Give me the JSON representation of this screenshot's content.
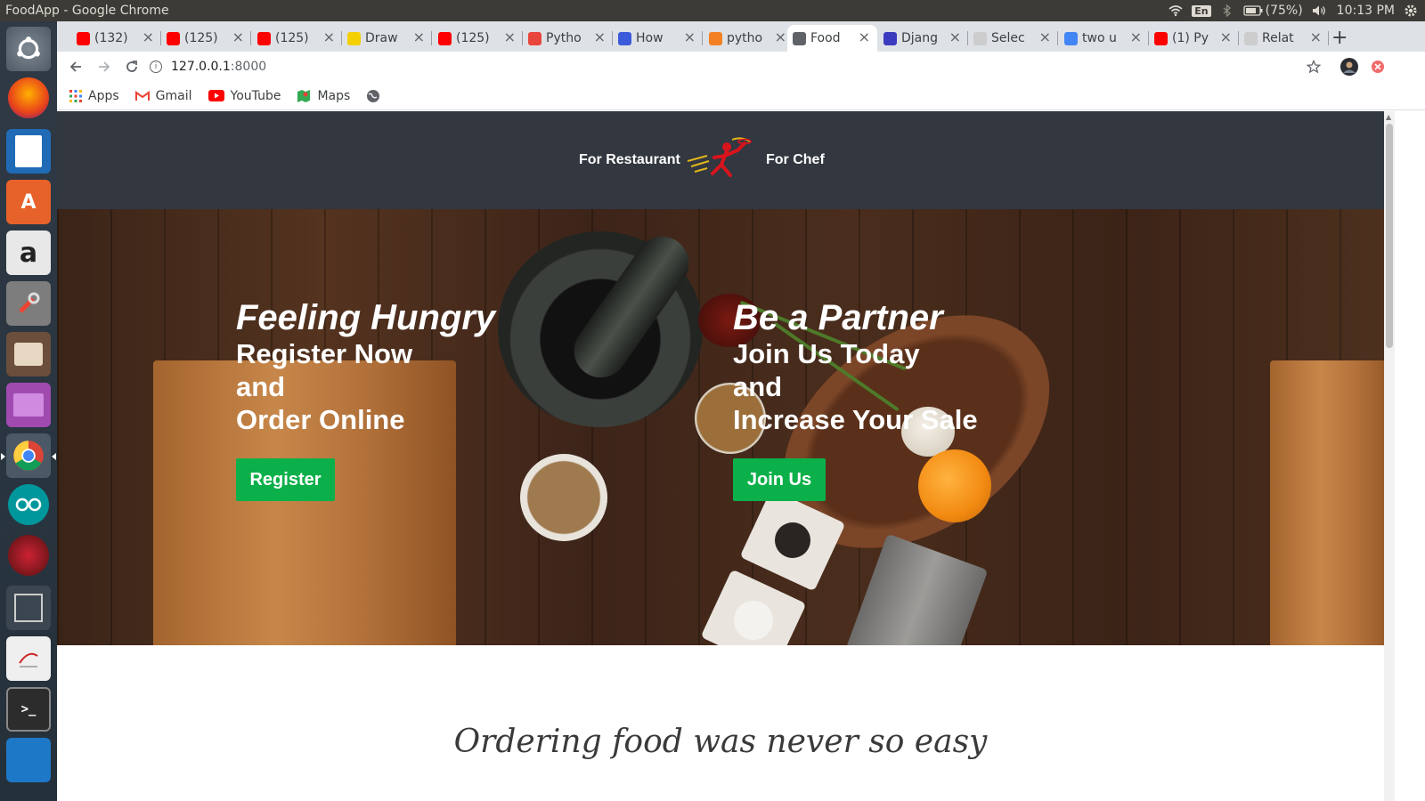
{
  "system": {
    "window_title": "FoodApp - Google Chrome",
    "lang": "En",
    "battery": "(75%)",
    "clock": "10:13 PM"
  },
  "launcher": {
    "items": [
      "dash",
      "firefox",
      "libreoffice-writer",
      "software-center",
      "amazon",
      "system-settings",
      "files",
      "media",
      "chrome",
      "arduino",
      "app",
      "workspace",
      "editor",
      "terminal",
      "vscode"
    ]
  },
  "tabs": [
    {
      "label": "(132)",
      "favicon": "youtube-icon",
      "color": "#ff0000"
    },
    {
      "label": "(125)",
      "favicon": "youtube-icon",
      "color": "#ff0000"
    },
    {
      "label": "(125)",
      "favicon": "youtube-icon",
      "color": "#ff0000"
    },
    {
      "label": "Draw",
      "favicon": "ejs-icon",
      "color": "#f5d000"
    },
    {
      "label": "(125)",
      "favicon": "youtube-icon",
      "color": "#ff0000"
    },
    {
      "label": "Pytho",
      "favicon": "python-icon",
      "color": "#e8453c"
    },
    {
      "label": "How",
      "favicon": "circle-icon",
      "color": "#3b5bdb"
    },
    {
      "label": "pytho",
      "favicon": "stackoverflow-icon",
      "color": "#f48024"
    },
    {
      "label": "Food",
      "favicon": "globe-icon",
      "color": "#5f6368"
    },
    {
      "label": "Djang",
      "favicon": "grid-icon",
      "color": "#3b3bbf"
    },
    {
      "label": "Selec",
      "favicon": "blank-icon",
      "color": "#cccccc"
    },
    {
      "label": "two u",
      "favicon": "google-icon",
      "color": "#4285f4"
    },
    {
      "label": "(1) Py",
      "favicon": "youtube-icon",
      "color": "#ff0000"
    },
    {
      "label": "Relat",
      "favicon": "blank-icon",
      "color": "#cccccc"
    }
  ],
  "active_tab_index": 8,
  "address": {
    "host": "127.0.0.1",
    "port": ":8000"
  },
  "bookmarks": [
    {
      "label": "Apps",
      "icon": "apps-grid-icon"
    },
    {
      "label": "Gmail",
      "icon": "gmail-icon"
    },
    {
      "label": "YouTube",
      "icon": "youtube-icon"
    },
    {
      "label": "Maps",
      "icon": "maps-icon"
    },
    {
      "label": "",
      "icon": "globe-icon"
    }
  ],
  "site": {
    "header": {
      "left_link": "For Restaurant",
      "right_link": "For Chef"
    },
    "hero": {
      "left": {
        "heading": "Feeling Hungry",
        "line1": "Register Now",
        "line2": "and",
        "line3": "Order Online",
        "button": "Register"
      },
      "right": {
        "heading": "Be a Partner",
        "line1": "Join Us Today",
        "line2": "and",
        "line3": "Increase Your Sale",
        "button": "Join Us"
      }
    },
    "tagline": "Ordering food was never so easy"
  },
  "colors": {
    "header_bg": "#323740",
    "button_green": "#0cb04a",
    "logo_red": "#d9141c"
  }
}
